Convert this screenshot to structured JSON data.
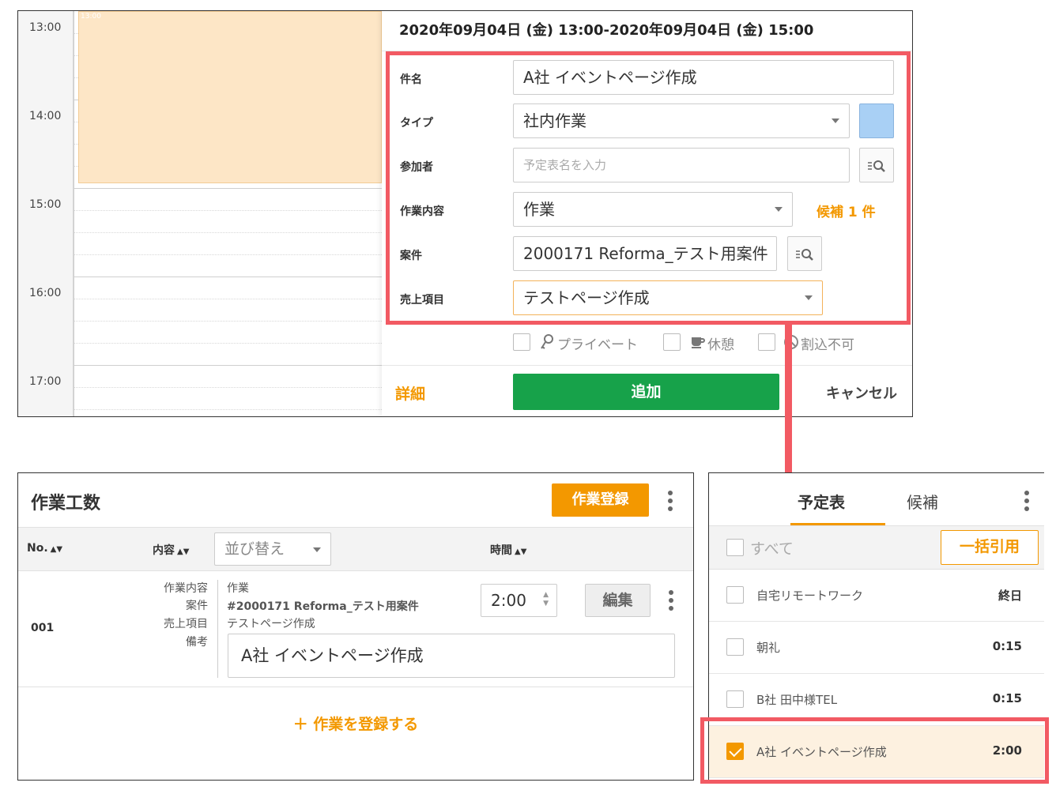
{
  "calendar": {
    "hours": [
      "13:00",
      "14:00",
      "15:00",
      "16:00",
      "17:00"
    ],
    "event_time_label": "13:00"
  },
  "popover": {
    "title": "2020年09月04日 (金) 13:00-2020年09月04日 (金) 15:00",
    "fields": {
      "name_label": "件名",
      "name_value": "A社 イベントページ作成",
      "type_label": "タイプ",
      "type_value": "社内作業",
      "type_color": "#a9d0f5",
      "participants_label": "参加者",
      "participants_placeholder": "予定表名を入力",
      "work_content_label": "作業内容",
      "work_content_value": "作業",
      "candidates_text": "候補 1 件",
      "project_label": "案件",
      "project_value": "2000171 Reforma_テスト用案件",
      "sales_item_label": "売上項目",
      "sales_item_value": "テストページ作成"
    },
    "options": {
      "private_label": "プライベート",
      "break_label": "休憩",
      "no_interrupt_label": "割込不可"
    },
    "footer": {
      "detail_label": "詳細",
      "add_label": "追加",
      "cancel_label": "キャンセル"
    }
  },
  "work_panel": {
    "title": "作業工数",
    "register_button": "作業登録",
    "columns": {
      "no": "No.",
      "content": "内容",
      "sort_placeholder": "並び替え",
      "time": "時間"
    },
    "row": {
      "no": "001",
      "labels": [
        "作業内容",
        "案件",
        "売上項目",
        "備考"
      ],
      "work_content": "作業",
      "project": "#2000171 Reforma_テスト用案件",
      "sales_item": "テストページ作成",
      "time": "2:00",
      "edit_label": "編集",
      "memo": "A社 イベントページ作成"
    },
    "add_work_label": "＋ 作業を登録する"
  },
  "schedule_panel": {
    "tabs": [
      "予定表",
      "候補"
    ],
    "active_tab": "予定表",
    "all_label": "すべて",
    "bulk_quote_label": "一括引用",
    "items": [
      {
        "title": "自宅リモートワーク",
        "time": "終日",
        "checked": false
      },
      {
        "title": "朝礼",
        "time": "0:15",
        "checked": false
      },
      {
        "title": "B社 田中様TEL",
        "time": "0:15",
        "checked": false
      },
      {
        "title": "A社 イベントページ作成",
        "time": "2:00",
        "checked": true
      }
    ]
  },
  "colors": {
    "accent_orange": "#f39800",
    "add_green": "#17a24a",
    "highlight_red": "#f25a63",
    "event_fill": "#fde6c6"
  }
}
